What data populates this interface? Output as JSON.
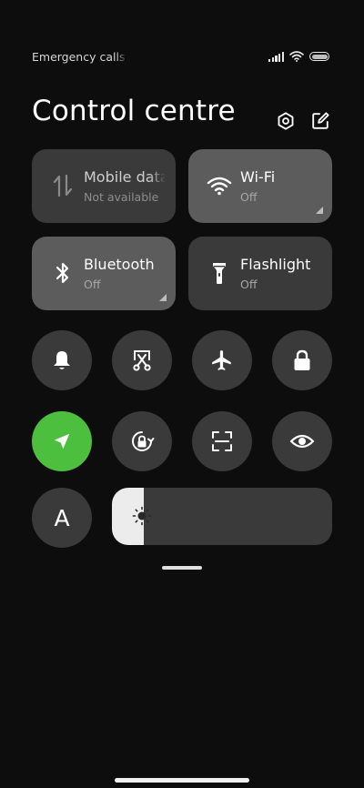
{
  "status_bar": {
    "carrier_text": "Emergency calls only",
    "icons": [
      "signal-icon",
      "wifi-icon",
      "battery-icon"
    ]
  },
  "header": {
    "title": "Control centre",
    "icons": [
      "settings-icon",
      "edit-icon"
    ]
  },
  "tiles": [
    {
      "title": "Mobile data",
      "subtitle": "Not available",
      "icon": "mobile-data-icon",
      "state": "unavailable"
    },
    {
      "title": "Wi-Fi",
      "subtitle": "Off",
      "icon": "wifi-icon",
      "state": "off",
      "expandable": true
    },
    {
      "title": "Bluetooth",
      "subtitle": "Off",
      "icon": "bluetooth-icon",
      "state": "off",
      "expandable": true
    },
    {
      "title": "Flashlight",
      "subtitle": "Off",
      "icon": "flashlight-icon",
      "state": "off"
    }
  ],
  "quick_toggles": [
    {
      "icon": "bell-icon",
      "active": false
    },
    {
      "icon": "screenshot-icon",
      "active": false
    },
    {
      "icon": "airplane-icon",
      "active": false
    },
    {
      "icon": "lock-icon",
      "active": false
    },
    {
      "icon": "location-icon",
      "active": true
    },
    {
      "icon": "rotation-lock-icon",
      "active": false
    },
    {
      "icon": "scan-icon",
      "active": false
    },
    {
      "icon": "eye-icon",
      "active": false
    },
    {
      "icon": "auto-brightness-icon",
      "label": "A",
      "active": false
    }
  ],
  "brightness": {
    "level": 0.145,
    "icon": "brightness-icon"
  },
  "colors": {
    "background": "#0d0d0d",
    "tile_on": "#5c5c5c",
    "tile_off": "#3a3a3a",
    "accent_active": "#4cbf3f",
    "slider_fill": "#ececec"
  }
}
